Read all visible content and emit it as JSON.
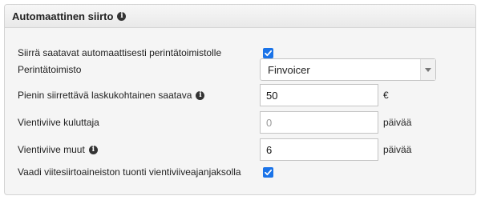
{
  "panel": {
    "title": "Automaattinen siirto",
    "title_icon": "info-icon"
  },
  "rows": {
    "auto_transfer": {
      "label": "Siirrä saatavat automaattisesti perintätoimistolle",
      "checked": true
    },
    "agency": {
      "label": "Perintätoimisto",
      "selected": "Finvoicer"
    },
    "min_amount": {
      "label": "Pienin siirrettävä laskukohtainen saatava",
      "value": "50",
      "unit": "€"
    },
    "delay_consumer": {
      "label": "Vientiviive kuluttaja",
      "placeholder": "0",
      "unit": "päivää"
    },
    "delay_other": {
      "label": "Vientiviive muut",
      "value": "6",
      "unit": "päivää"
    },
    "require_import": {
      "label": "Vaadi viitesiirtoaineiston tuonti vientiviiveajanjaksolla",
      "checked": true
    }
  },
  "colors": {
    "checkbox": "#1a73e8",
    "panel_bg": "#f5f5f5"
  }
}
